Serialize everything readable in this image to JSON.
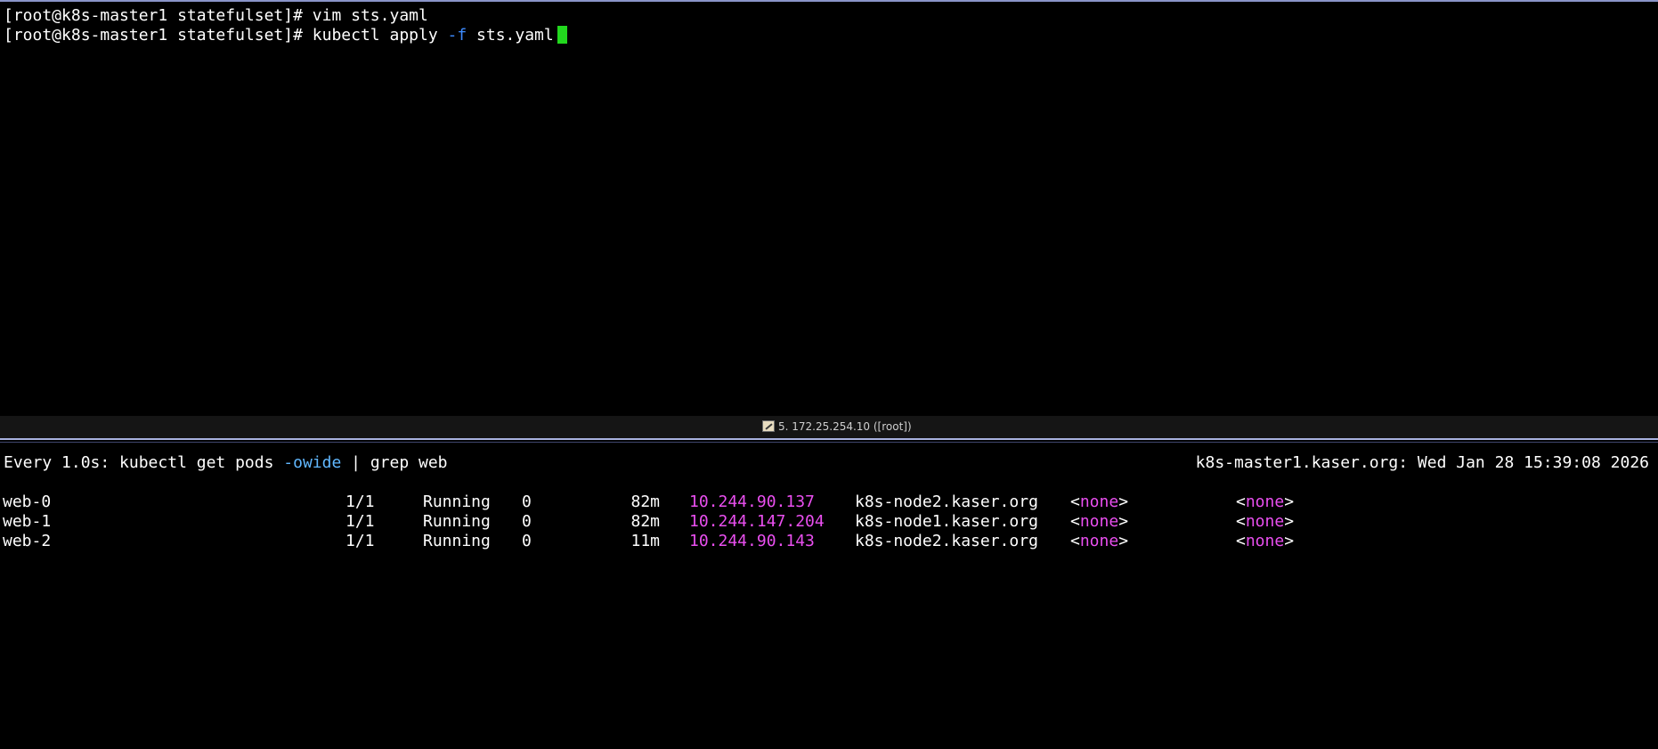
{
  "top_pane": {
    "line1": {
      "prompt": "[root@k8s-master1 statefulset]# ",
      "command": "vim sts.yaml"
    },
    "line2": {
      "prompt": "[root@k8s-master1 statefulset]# ",
      "cmd_part1": "kubectl apply ",
      "flag": "-f",
      "cmd_part2": " sts.yaml"
    }
  },
  "status_bar": {
    "icon": "pencil-icon",
    "label": "5. 172.25.254.10 ([root])"
  },
  "watch": {
    "prefix": "Every 1.0s: kubectl get pods ",
    "option": "-owide",
    "suffix": " | grep web",
    "host_time": "k8s-master1.kaser.org: Wed Jan 28 15:39:08 2026"
  },
  "pods": [
    {
      "name": "web-0",
      "ready": "1/1",
      "status": "Running",
      "restarts": "0",
      "age": "82m",
      "ip": "10.244.90.137",
      "node": "k8s-node2.kaser.org",
      "nominated_node": "none",
      "readiness_gates": "none"
    },
    {
      "name": "web-1",
      "ready": "1/1",
      "status": "Running",
      "restarts": "0",
      "age": "82m",
      "ip": "10.244.147.204",
      "node": "k8s-node1.kaser.org",
      "nominated_node": "none",
      "readiness_gates": "none"
    },
    {
      "name": "web-2",
      "ready": "1/1",
      "status": "Running",
      "restarts": "0",
      "age": "11m",
      "ip": "10.244.90.143",
      "node": "k8s-node2.kaser.org",
      "nominated_node": "none",
      "readiness_gates": "none"
    }
  ],
  "colors": {
    "ip_highlight": "#ea4ff0",
    "flag_highlight": "#3d8bff",
    "cursor": "#22d81e",
    "pane_border": "#a9b2e0"
  }
}
